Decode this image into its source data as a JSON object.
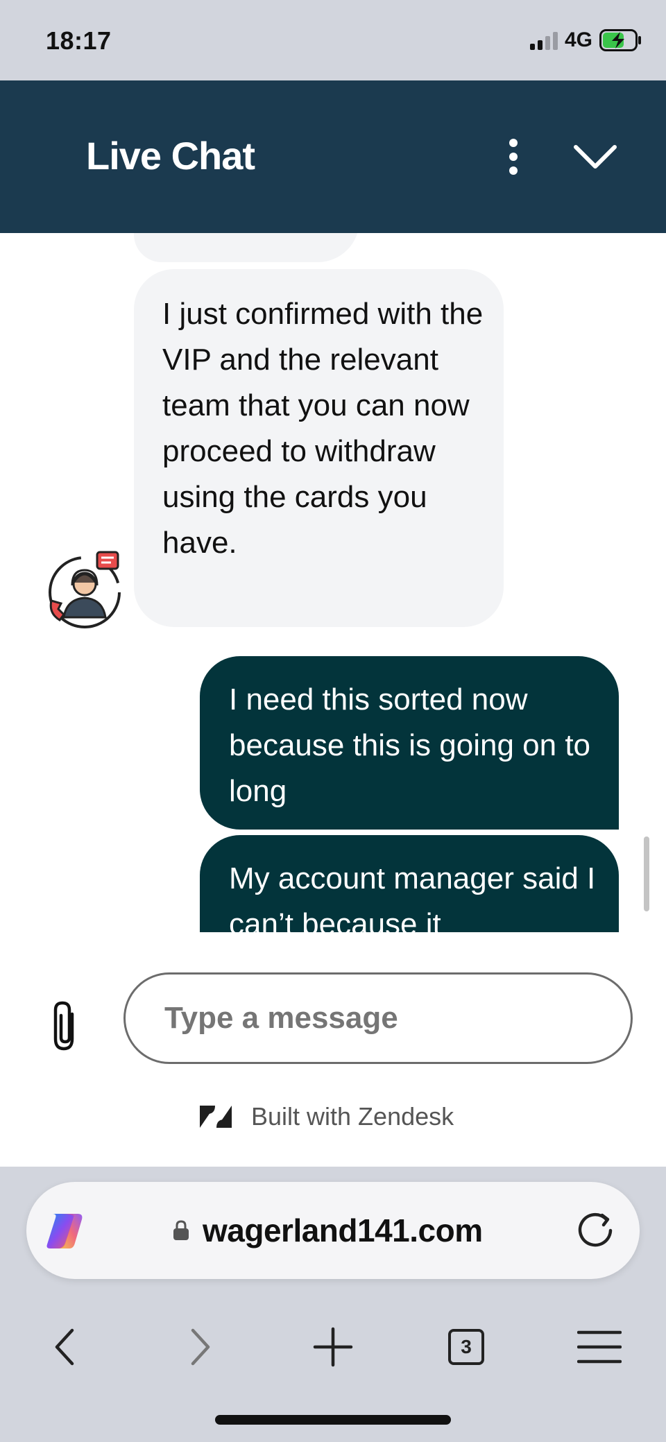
{
  "status_bar": {
    "time": "18:17",
    "network": "4G"
  },
  "header": {
    "title": "Live Chat"
  },
  "messages": {
    "agent_message": "I just confirmed with the VIP and the relevant team that you can now proceed to withdraw using the cards you have.",
    "user_message_1": "I need this sorted now because this is going on to long",
    "user_message_2": "My account manager said I can’t because it"
  },
  "composer": {
    "placeholder": "Type a message"
  },
  "branding": {
    "text": "Built with Zendesk"
  },
  "browser": {
    "url": "wagerland141.com",
    "tab_count": "3"
  },
  "colors": {
    "header_bg": "#1b3a4f",
    "user_bubble": "#03343b",
    "agent_bubble": "#f3f4f6"
  }
}
